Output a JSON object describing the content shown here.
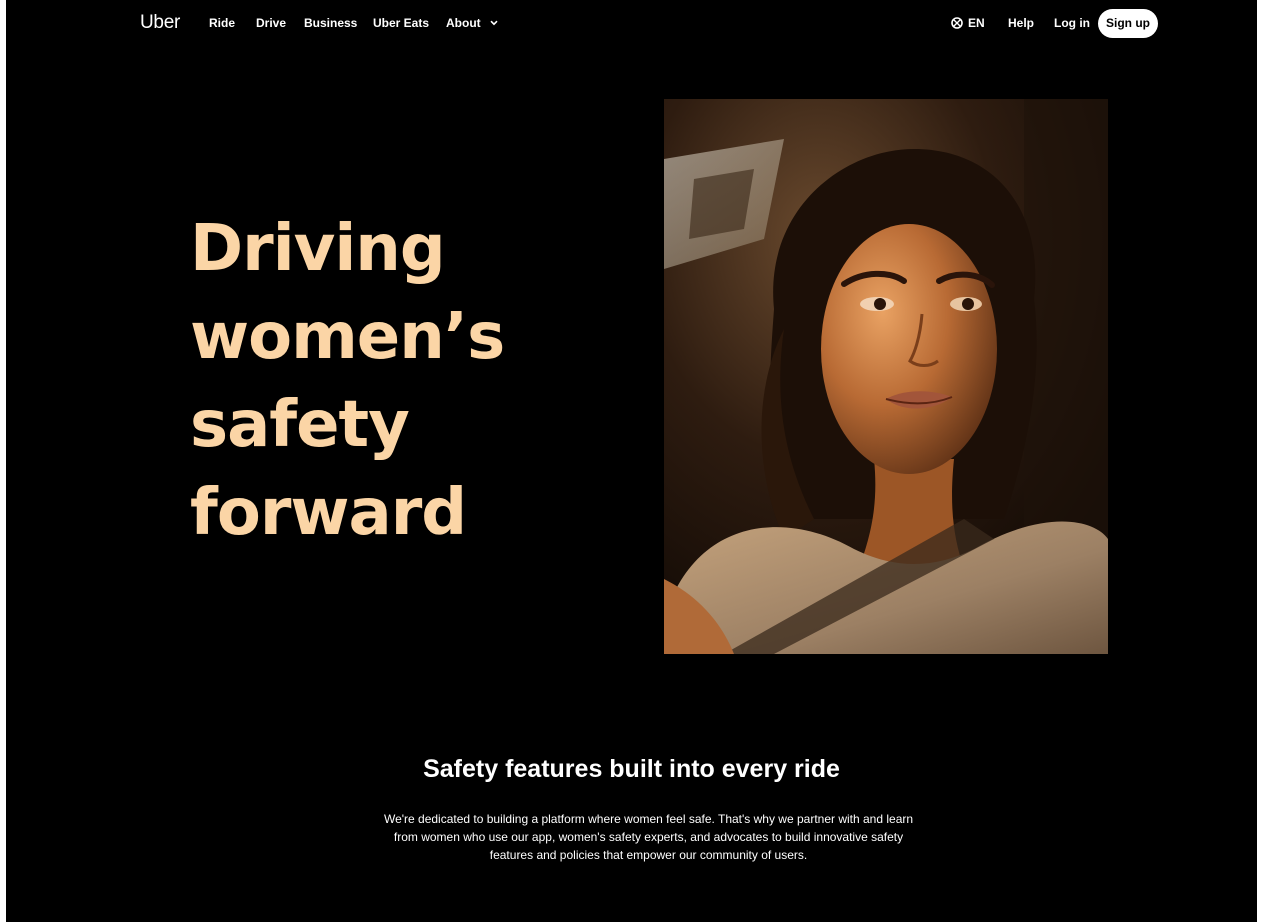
{
  "nav": {
    "logo": "Uber",
    "links": [
      "Ride",
      "Drive",
      "Business",
      "Uber Eats"
    ],
    "about": "About",
    "language": "EN",
    "help": "Help",
    "login": "Log in",
    "signup": "Sign up"
  },
  "hero": {
    "title_lines": [
      "Driving",
      "women’s",
      "safety",
      "forward"
    ],
    "accent_color": "#fbd5a6"
  },
  "safety": {
    "title": "Safety features built into every ride",
    "body_lines": [
      "We're dedicated to building a platform where women feel safe. That's why we partner with and learn",
      "from women who use our app, women's safety experts, and advocates to build innovative safety",
      "features and policies that empower our community of users."
    ]
  }
}
